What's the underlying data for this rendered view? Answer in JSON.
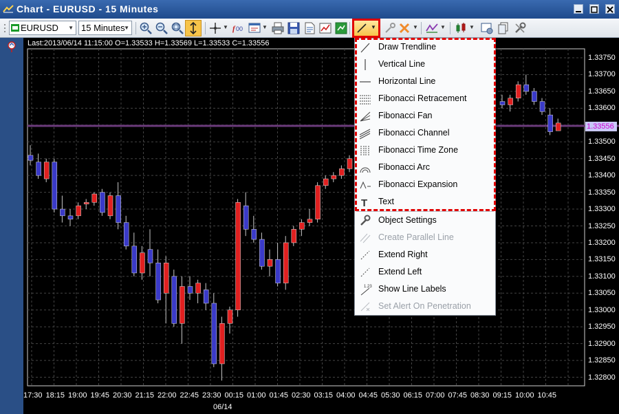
{
  "window": {
    "title": "Chart - EURUSD - 15 Minutes"
  },
  "toolbar": {
    "symbol": "EURUSD",
    "timeframe": "15 Minutes",
    "line_tool_icon": "trendline-icon"
  },
  "chart": {
    "info": "Last:2013/06/14 11:15:00 O=1.33533 H=1.33569 L=1.33533 C=1.33556",
    "current_price": "1.33556",
    "price_labels": [
      "1.33750",
      "1.33700",
      "1.33650",
      "1.33600",
      "1.33550",
      "1.33500",
      "1.33450",
      "1.33400",
      "1.33350",
      "1.33300",
      "1.33250",
      "1.33200",
      "1.33150",
      "1.33100",
      "1.33050",
      "1.33000",
      "1.32950",
      "1.32900",
      "1.32850",
      "1.32800"
    ],
    "time_labels": [
      "17:30",
      "18:15",
      "19:00",
      "19:45",
      "20:30",
      "21:15",
      "22:00",
      "22:45",
      "23:30",
      "00:15",
      "01:00",
      "01:45",
      "02:30",
      "03:15",
      "04:00",
      "04:45",
      "05:30",
      "06:15",
      "07:00",
      "07:45",
      "08:30",
      "09:15",
      "10:00",
      "10:45"
    ],
    "date_label": "06/14",
    "colors": {
      "up": "#e02020",
      "down": "#3a3ac8",
      "grid": "#444444",
      "current_line": "#6a3a7a"
    }
  },
  "menu": {
    "items": [
      {
        "label": "Draw Trendline",
        "icon": "trendline-icon"
      },
      {
        "label": "Vertical Line",
        "icon": "vertical-line-icon"
      },
      {
        "label": "Horizontal Line",
        "icon": "horizontal-line-icon"
      },
      {
        "label": "Fibonacci Retracement",
        "icon": "fib-retracement-icon"
      },
      {
        "label": "Fibonacci Fan",
        "icon": "fib-fan-icon"
      },
      {
        "label": "Fibonacci Channel",
        "icon": "fib-channel-icon"
      },
      {
        "label": "Fibonacci Time Zone",
        "icon": "fib-timezone-icon"
      },
      {
        "label": "Fibonacci Arc",
        "icon": "fib-arc-icon"
      },
      {
        "label": "Fibonacci Expansion",
        "icon": "fib-expansion-icon"
      },
      {
        "label": "Text",
        "icon": "text-icon"
      }
    ],
    "items2": [
      {
        "label": "Object Settings",
        "icon": "wrench-icon",
        "disabled": false
      },
      {
        "label": "Create Parallel Line",
        "icon": "parallel-line-icon",
        "disabled": true
      },
      {
        "label": "Extend Right",
        "icon": "extend-right-icon",
        "disabled": false
      },
      {
        "label": "Extend Left",
        "icon": "extend-left-icon",
        "disabled": false
      },
      {
        "label": "Show Line Labels",
        "icon": "line-labels-icon",
        "disabled": false
      },
      {
        "label": "Set Alert On Penetration",
        "icon": "alert-icon",
        "disabled": true
      }
    ]
  }
}
